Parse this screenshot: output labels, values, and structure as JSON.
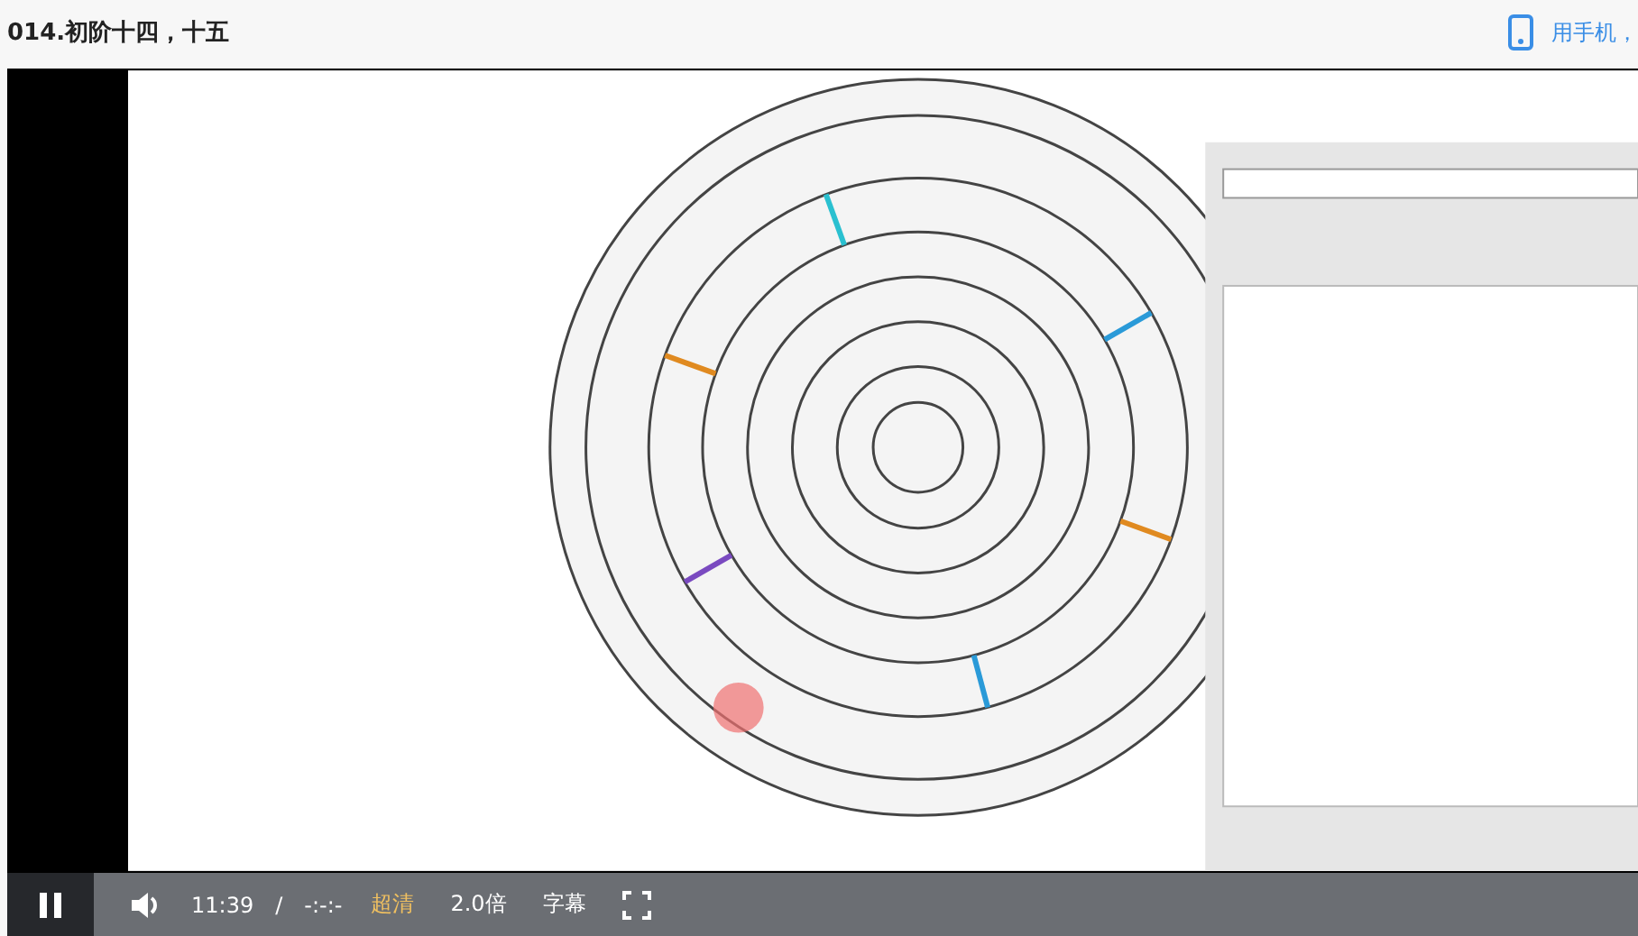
{
  "title": "014.初阶十四，十五",
  "mobile_link": "用手机，",
  "video": {
    "kind": "picture",
    "playing": true
  },
  "controls": {
    "time": "11:39",
    "separator": "/",
    "duration": "-:-:-",
    "quality": "超清",
    "speed": "2.0倍",
    "subtitles": "字幕"
  }
}
